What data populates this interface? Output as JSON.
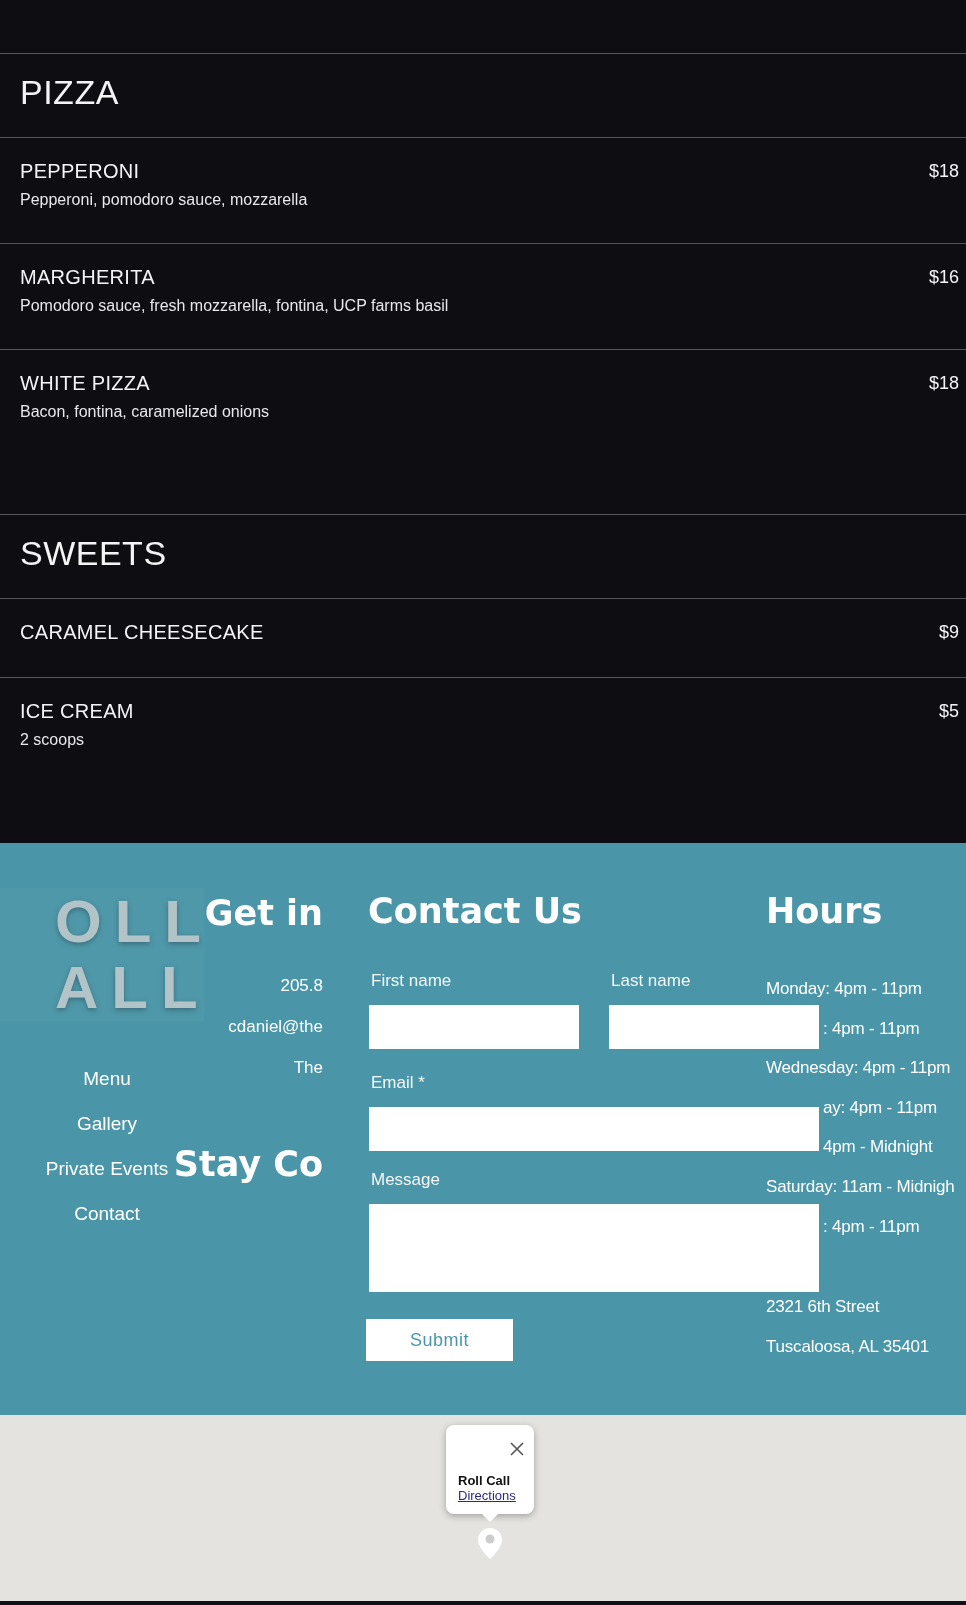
{
  "menu": {
    "sections": [
      {
        "title": "PIZZA",
        "items": [
          {
            "name": "PEPPERONI",
            "description": "Pepperoni, pomodoro sauce, mozzarella",
            "price": "$18"
          },
          {
            "name": "MARGHERITA",
            "description": "Pomodoro sauce, fresh mozzarella, fontina, UCP farms basil",
            "price": "$16"
          },
          {
            "name": "WHITE PIZZA",
            "description": "Bacon, fontina, caramelized onions",
            "price": "$18"
          }
        ]
      },
      {
        "title": "SWEETS",
        "items": [
          {
            "name": "CARAMEL CHEESECAKE",
            "price": "$9"
          },
          {
            "name": "ICE CREAM",
            "description": "2 scoops",
            "price": "$5"
          }
        ]
      }
    ]
  },
  "footer": {
    "logo": {
      "lines": [
        "OLL",
        "ALL"
      ]
    },
    "nav": [
      "Menu",
      "Gallery",
      "Private Events",
      "Contact"
    ],
    "get_in_touch": {
      "heading": "Get in",
      "lines": [
        "205.8",
        "cdaniel@the",
        "The"
      ]
    },
    "stay_connected": {
      "heading": "Stay Co"
    },
    "contact_form": {
      "heading": "Contact Us",
      "rows": [
        [
          {
            "label": "First name",
            "kind": "line"
          },
          {
            "label": "Last name",
            "kind": "line"
          }
        ],
        [
          {
            "label": "Email *",
            "kind": "line"
          }
        ],
        [
          {
            "label": "Message",
            "kind": "area"
          }
        ]
      ],
      "submit": "Submit"
    },
    "hours": {
      "heading": "Hours",
      "lines": [
        {
          "text": "Monday: 4pm - 11pm",
          "kind": "full"
        },
        {
          "text": ": 4pm - 11pm",
          "kind": "partial"
        },
        {
          "text": "Wednesday: 4pm - 11pm",
          "kind": "full"
        },
        {
          "text": "ay: 4pm - 11pm",
          "kind": "partial"
        },
        {
          "text": "4pm - Midnight",
          "kind": "partial"
        },
        {
          "text": "Saturday: 11am - Midnigh",
          "kind": "full"
        },
        {
          "text": ": 4pm - 11pm",
          "kind": "partial"
        }
      ],
      "address": [
        "2321 6th Street",
        "Tuscaloosa, AL 35401"
      ]
    }
  },
  "map": {
    "popup": {
      "title": "Roll Call",
      "link": "Directions"
    }
  }
}
